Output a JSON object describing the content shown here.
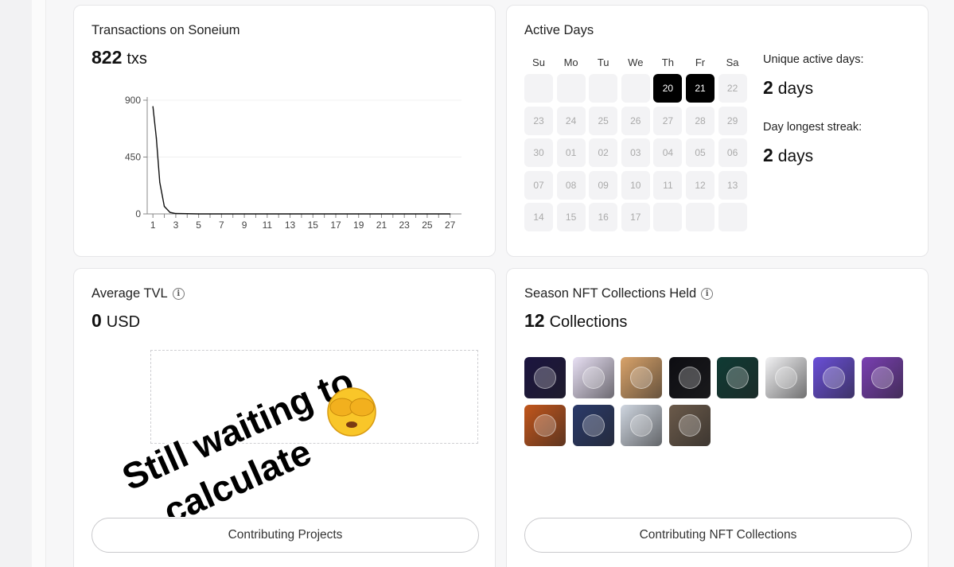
{
  "tx_card": {
    "title": "Transactions on Soneium",
    "value": "822",
    "unit": "txs"
  },
  "chart_data": {
    "type": "line",
    "x": [
      1,
      1.3,
      1.6,
      2,
      2.5,
      3,
      5,
      7,
      9,
      11,
      13,
      15,
      17,
      19,
      21,
      23,
      25,
      27
    ],
    "y": [
      850,
      600,
      250,
      60,
      12,
      3,
      0,
      0,
      0,
      0,
      0,
      0,
      0,
      0,
      0,
      0,
      0,
      0
    ],
    "x_ticks": [
      "1",
      "3",
      "5",
      "7",
      "9",
      "11",
      "13",
      "15",
      "17",
      "19",
      "21",
      "23",
      "25",
      "27"
    ],
    "y_ticks": [
      "900",
      "450",
      "0"
    ],
    "ylim": [
      0,
      900
    ],
    "xlim": [
      0.5,
      28
    ],
    "title": "",
    "xlabel": "",
    "ylabel": ""
  },
  "active_days": {
    "title": "Active Days",
    "weekdays": [
      "Su",
      "Mo",
      "Tu",
      "We",
      "Th",
      "Fr",
      "Sa"
    ],
    "rows": [
      [
        "",
        "",
        "",
        "",
        "20",
        "21",
        "22"
      ],
      [
        "23",
        "24",
        "25",
        "26",
        "27",
        "28",
        "29"
      ],
      [
        "30",
        "01",
        "02",
        "03",
        "04",
        "05",
        "06"
      ],
      [
        "07",
        "08",
        "09",
        "10",
        "11",
        "12",
        "13"
      ],
      [
        "14",
        "15",
        "16",
        "17",
        "",
        "",
        ""
      ]
    ],
    "active": [
      "20",
      "21"
    ],
    "unique_label": "Unique active days:",
    "unique_value": "2",
    "unique_unit": "days",
    "streak_label": "Day longest streak:",
    "streak_value": "2",
    "streak_unit": "days"
  },
  "tvl_card": {
    "title": "Average TVL",
    "value": "0",
    "unit": "USD",
    "button": "Contributing Projects"
  },
  "overlay": {
    "line1": "Still waiting to",
    "line2": "calculate",
    "emoji": "🫣"
  },
  "nft_card": {
    "title": "Season NFT Collections Held",
    "value": "12",
    "unit": "Collections",
    "button": "Contributing NFT Collections",
    "items": [
      {
        "icon": "nft-dark-logo-icon",
        "color": "#1b1440"
      },
      {
        "icon": "nft-robot-dog-icon",
        "color": "#e8e0f4"
      },
      {
        "icon": "nft-anime-group-icon",
        "color": "#d9a36a"
      },
      {
        "icon": "nft-soneium-id-icon",
        "color": "#0d0d12"
      },
      {
        "icon": "nft-green-card-icon",
        "color": "#0f3b34"
      },
      {
        "icon": "nft-hex-badge-icon",
        "color": "#f2f2f4"
      },
      {
        "icon": "nft-purple-phone-icon",
        "color": "#6a4fd8"
      },
      {
        "icon": "nft-treasure-chest-icon",
        "color": "#7a3fb3"
      },
      {
        "icon": "nft-orange-portal-icon",
        "color": "#c2561c"
      },
      {
        "icon": "nft-cube-burst-icon",
        "color": "#2a3a6a"
      },
      {
        "icon": "nft-city-scene-icon",
        "color": "#cfd6e0"
      },
      {
        "icon": "nft-blockchain-games-icon",
        "color": "#6b5a4a"
      }
    ]
  }
}
